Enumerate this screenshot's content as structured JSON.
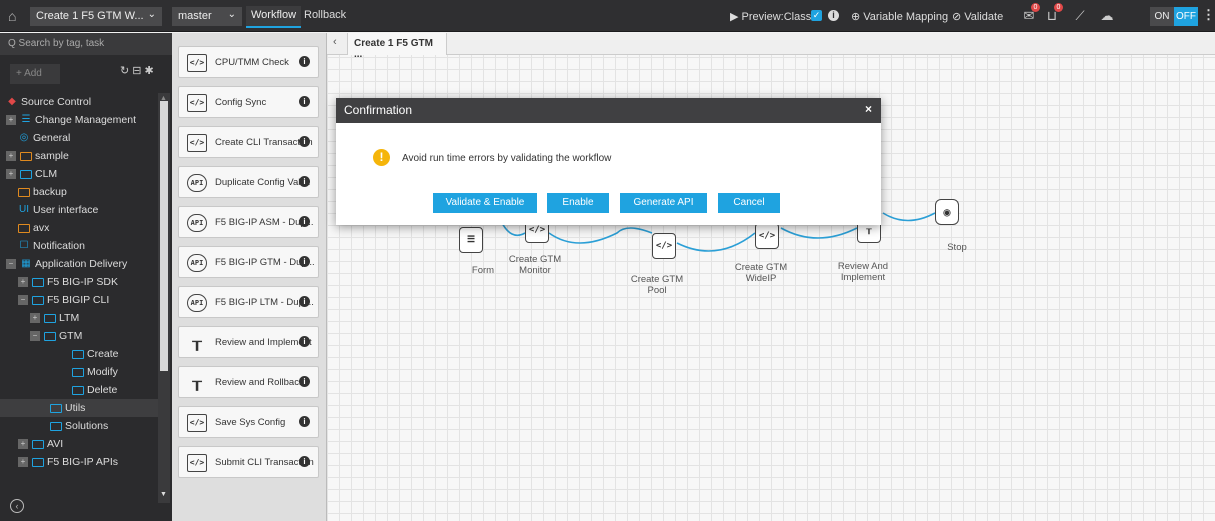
{
  "topbar": {
    "workflow_name": "Create 1 F5 GTM W...",
    "branch": "master",
    "tab_workflow": "Workflow",
    "tab_rollback": "Rollback",
    "preview": "▶ Preview:Classic",
    "variable_mapping": "⊕ Variable Mapping",
    "validate": "⊘ Validate",
    "badge_1": "0",
    "badge_2": "0",
    "toggle_on": "ON",
    "toggle_off": "OFF"
  },
  "sidebar": {
    "search_placeholder": "Q  Search by tag, task",
    "add_label": "+ Add",
    "tree": [
      {
        "label": "Source Control",
        "indent": 0,
        "toggle": "",
        "icon": "diamond",
        "selected": false
      },
      {
        "label": "Change Management",
        "indent": 0,
        "toggle": "+",
        "icon": "list",
        "selected": false
      },
      {
        "label": "General",
        "indent": 1,
        "toggle": "",
        "icon": "ring",
        "selected": false
      },
      {
        "label": "sample",
        "indent": 0,
        "toggle": "+",
        "icon": "folder-orange",
        "selected": false
      },
      {
        "label": "CLM",
        "indent": 0,
        "toggle": "+",
        "icon": "folder",
        "selected": false
      },
      {
        "label": "backup",
        "indent": 1,
        "toggle": "",
        "icon": "folder-orange",
        "selected": false
      },
      {
        "label": "User interface",
        "indent": 1,
        "toggle": "",
        "icon": "ui",
        "selected": false
      },
      {
        "label": "avx",
        "indent": 1,
        "toggle": "",
        "icon": "folder-orange",
        "selected": false
      },
      {
        "label": "Notification",
        "indent": 1,
        "toggle": "",
        "icon": "bell",
        "selected": false
      },
      {
        "label": "Application Delivery",
        "indent": 0,
        "toggle": "−",
        "icon": "grid",
        "selected": false
      },
      {
        "label": "F5 BIG-IP SDK",
        "indent": 1,
        "toggle": "+",
        "icon": "folder",
        "selected": false
      },
      {
        "label": "F5 BIGIP CLI",
        "indent": 1,
        "toggle": "−",
        "icon": "folder",
        "selected": false
      },
      {
        "label": "LTM",
        "indent": 2,
        "toggle": "+",
        "icon": "folder",
        "selected": false
      },
      {
        "label": "GTM",
        "indent": 2,
        "toggle": "−",
        "icon": "folder",
        "selected": false
      },
      {
        "label": "Create",
        "indent": 4,
        "toggle": "",
        "icon": "folder",
        "selected": false
      },
      {
        "label": "Modify",
        "indent": 4,
        "toggle": "",
        "icon": "folder",
        "selected": false
      },
      {
        "label": "Delete",
        "indent": 4,
        "toggle": "",
        "icon": "folder",
        "selected": false
      },
      {
        "label": "Utils",
        "indent": 3,
        "toggle": "",
        "icon": "folder",
        "selected": true
      },
      {
        "label": "Solutions",
        "indent": 3,
        "toggle": "",
        "icon": "folder",
        "selected": false
      },
      {
        "label": "AVI",
        "indent": 1,
        "toggle": "+",
        "icon": "folder",
        "selected": false
      },
      {
        "label": "F5 BIG-IP APIs",
        "indent": 1,
        "toggle": "+",
        "icon": "folder",
        "selected": false
      }
    ]
  },
  "palette": {
    "tasks": [
      {
        "label": "CPU/TMM Check",
        "icon": "code",
        "info": true
      },
      {
        "label": "Config Sync",
        "icon": "code",
        "info": true
      },
      {
        "label": "Create CLI Transaction",
        "icon": "code",
        "info": true
      },
      {
        "label": "Duplicate Config Vali...",
        "icon": "api",
        "info": true
      },
      {
        "label": "F5 BIG-IP ASM - Dup...",
        "icon": "api",
        "info": true
      },
      {
        "label": "F5 BIG-IP GTM - Dup...",
        "icon": "api",
        "info": true
      },
      {
        "label": "F5 BIG-IP LTM - Dupl...",
        "icon": "api",
        "info": true
      },
      {
        "label": "Review and Implement",
        "icon": "tree",
        "info": true
      },
      {
        "label": "Review and Rollback",
        "icon": "tree",
        "info": true
      },
      {
        "label": "Save Sys Config",
        "icon": "code",
        "info": true
      },
      {
        "label": "Submit CLI Transaction",
        "icon": "code",
        "info": true
      }
    ]
  },
  "canvas": {
    "tab_title": "Create 1 F5 GTM ...",
    "nodes": [
      {
        "label_lines": [
          "Form"
        ],
        "glyph": "☰"
      },
      {
        "label_lines": [
          "Create GTM",
          "Monitor"
        ],
        "glyph": "</>"
      },
      {
        "label_lines": [
          "Create GTM",
          "Pool"
        ],
        "glyph": "</>"
      },
      {
        "label_lines": [
          "Create GTM",
          "WideIP"
        ],
        "glyph": "</>"
      },
      {
        "label_lines": [
          "Review And",
          "Implement"
        ],
        "glyph": "┰"
      },
      {
        "label_lines": [
          "Stop"
        ],
        "glyph": "◉"
      }
    ],
    "edge_color": "#2b9fd6"
  },
  "modal": {
    "title": "Confirmation",
    "close": "×",
    "message": "Avoid run time errors by validating the workflow",
    "buttons": [
      "Validate & Enable",
      "Enable",
      "Generate API",
      "Cancel"
    ],
    "accent": "#1fa3e0",
    "warning_color": "#f5b50a"
  }
}
